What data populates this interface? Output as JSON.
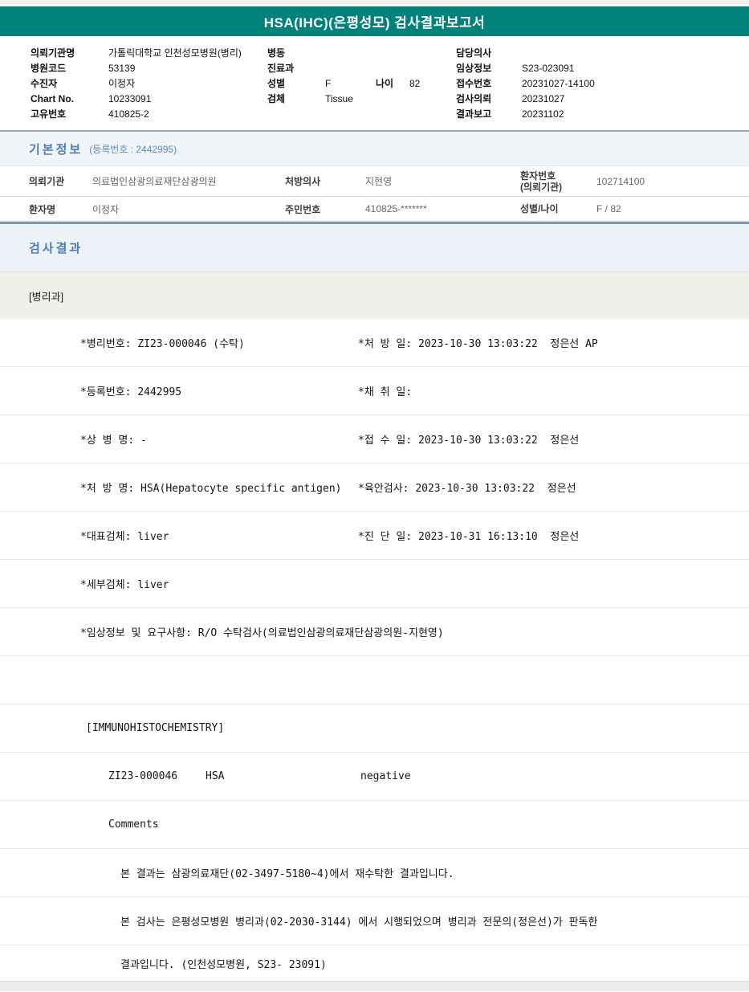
{
  "header": {
    "title": "HSA(IHC)(은평성모) 검사결과보고서"
  },
  "info": {
    "left": [
      {
        "label": "의뢰기관명",
        "value": "가톨릭대학교 인천성모병원(병리)"
      },
      {
        "label": "병원코드",
        "value": "53139"
      },
      {
        "label": "수진자",
        "value": "이정자"
      },
      {
        "label": "Chart No.",
        "value": "10233091"
      },
      {
        "label": "고유번호",
        "value": "410825-2"
      }
    ],
    "middle": {
      "ward_label": "병동",
      "ward_value": "",
      "dept_label": "진료과",
      "dept_value": "",
      "sex_label": "성별",
      "sex_value": "F",
      "age_label": "나이",
      "age_value": "82",
      "specimen_label": "검체",
      "specimen_value": "Tissue"
    },
    "right": [
      {
        "label": "담당의사",
        "value": ""
      },
      {
        "label": "임상정보",
        "value": "S23-023091"
      },
      {
        "label": "접수번호",
        "value": "20231027-14100"
      },
      {
        "label": "검사의뢰",
        "value": "20231027"
      },
      {
        "label": "결과보고",
        "value": "20231102"
      }
    ]
  },
  "basic_info": {
    "title": "기본정보",
    "reg_note": "(등록번호 : 2442995)",
    "row1": {
      "c1_label": "의뢰기관",
      "c1_value": "의료법인삼광의료재단삼광의원",
      "c2_label": "처방의사",
      "c2_value": "지현영",
      "c3_label_line1": "환자번호",
      "c3_label_line2": "(의뢰기관)",
      "c3_value": "102714100"
    },
    "row2": {
      "c1_label": "환자명",
      "c1_value": "이정자",
      "c2_label": "주민번호",
      "c2_value": "410825-*******",
      "c3_label": "성별/나이",
      "c3_value": "F / 82"
    }
  },
  "results": {
    "title": "검사결과",
    "department": "[병리과]",
    "detail_rows": [
      {
        "left": "*병리번호: ZI23-000046 (수탁)",
        "right": "*처 방 일: 2023-10-30 13:03:22  정은선 AP"
      },
      {
        "left": "*등록번호: 2442995",
        "right": "*채 취 일:"
      },
      {
        "left": "*상 병 명: -",
        "right": "*접 수 일: 2023-10-30 13:03:22  정은선"
      },
      {
        "left": "*처 방 명: HSA(Hepatocyte specific antigen)",
        "right": "*육안검사: 2023-10-30 13:03:22  정은선"
      },
      {
        "left": "*대표검체: liver",
        "right": "*진 단 일: 2023-10-31 16:13:10  정은선"
      },
      {
        "left": "*세부검체: liver",
        "right": ""
      },
      {
        "left": "*임상정보 및 요구사항: R/O 수탁검사(의료법인삼광의료재단삼광의원-지현영)",
        "right": ""
      }
    ],
    "ihc_header": "[IMMUNOHISTOCHEMISTRY]",
    "ihc_result": {
      "code": "ZI23-000046",
      "test": "HSA",
      "value": "negative"
    },
    "comments_label": "Comments",
    "comment_lines": [
      "본 결과는 삼광의료재단(02-3497-5180~4)에서 재수탁한 결과입니다.",
      "본 검사는 은평성모병원 병리과(02-2030-3144) 에서 시행되었으며 병리과 전문의(정은선)가 판독한",
      "결과입니다. (인천성모병원, S23- 23091)"
    ]
  },
  "colors": {
    "banner_teal": "#00817a",
    "section_title_blue": "#4d7eb2",
    "basic_bg": "#f1f5f9",
    "results_bg": "#ecf2f8",
    "department_bg": "#f0efea",
    "separator_blue": "#7e9ab6"
  }
}
